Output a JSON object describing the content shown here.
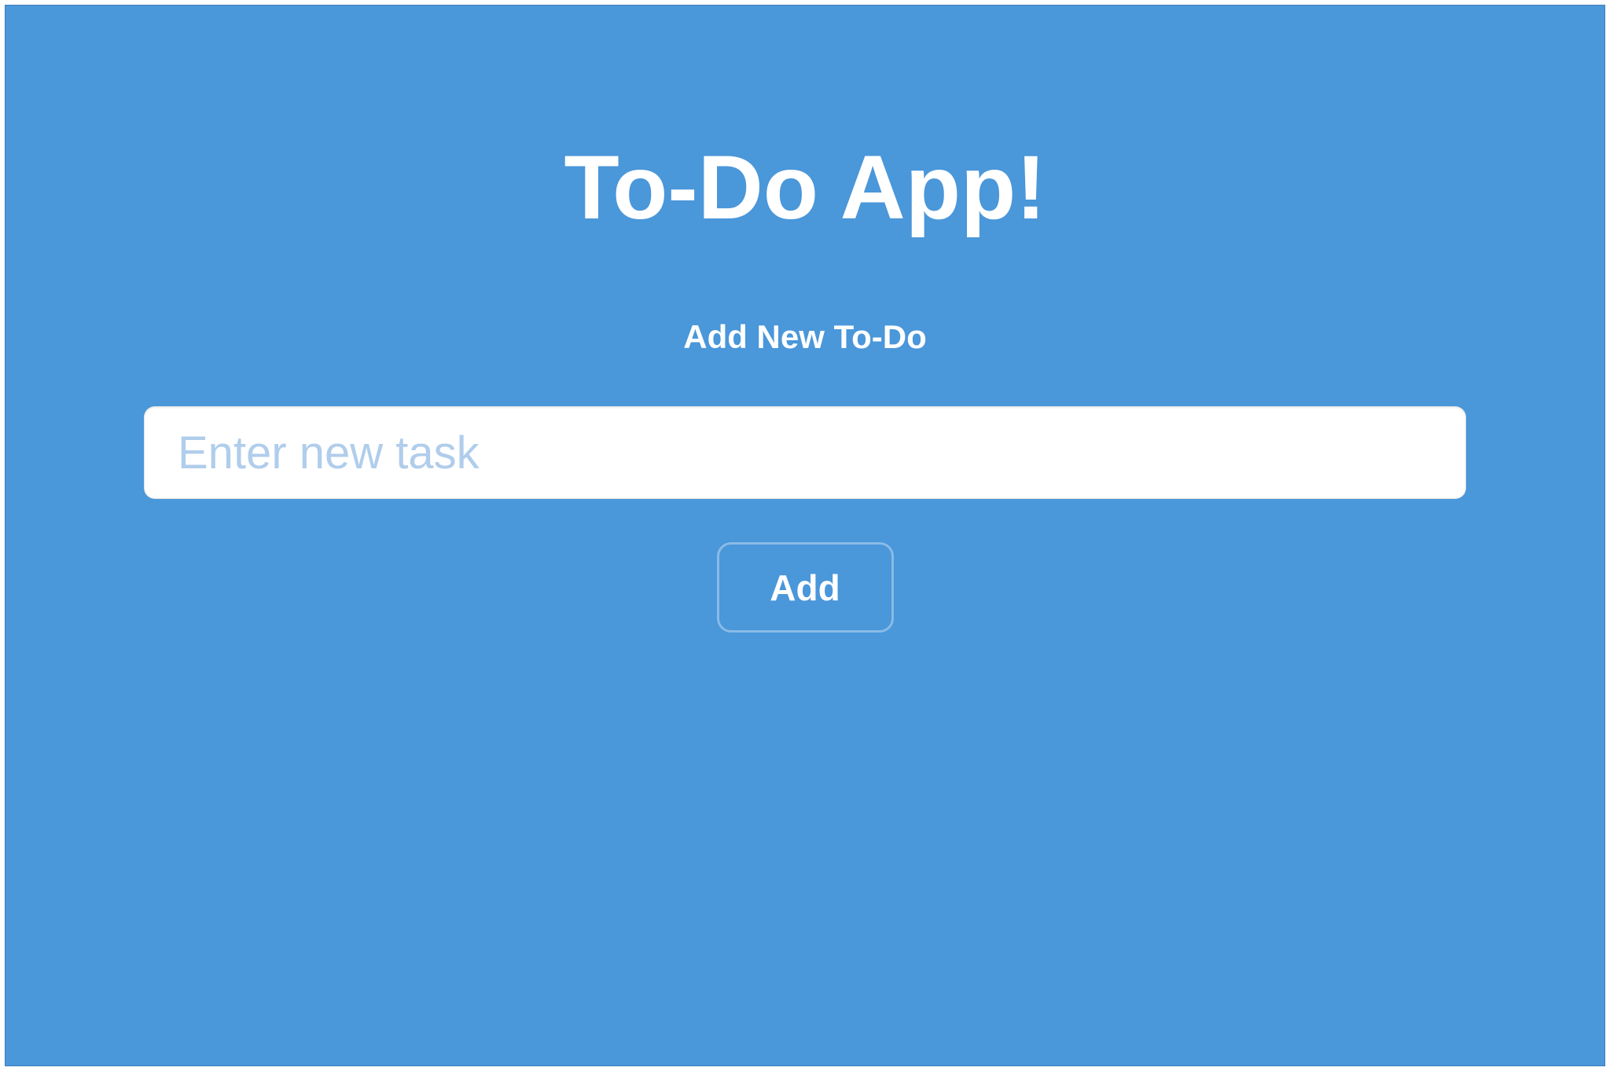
{
  "header": {
    "title": "To-Do App!",
    "subtitle": "Add New To-Do"
  },
  "form": {
    "task_input": {
      "placeholder": "Enter new task",
      "value": ""
    },
    "add_button_label": "Add"
  }
}
